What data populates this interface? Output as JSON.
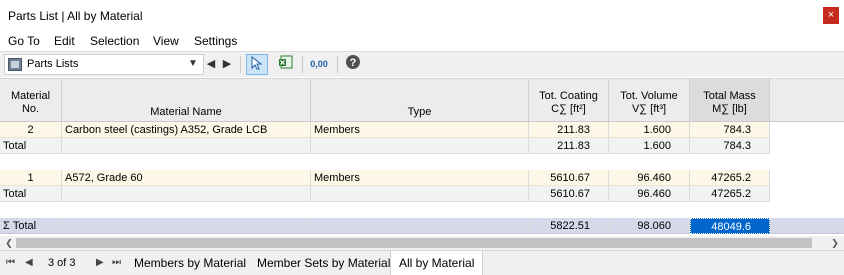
{
  "window": {
    "title": "Parts List | All by Material",
    "close_glyph": "×"
  },
  "menu": [
    "Go To",
    "Edit",
    "Selection",
    "View",
    "Settings"
  ],
  "toolbar": {
    "combo_value": "Parts Lists",
    "decimals_label": "0,00"
  },
  "table": {
    "headers": {
      "material_no": [
        "Material",
        "No."
      ],
      "material_name": "Material Name",
      "type": "Type",
      "coating": [
        "Tot. Coating",
        "C∑ [ft²]"
      ],
      "volume": [
        "Tot. Volume",
        "V∑ [ft³]"
      ],
      "mass": [
        "Total Mass",
        "M∑ [lb]"
      ]
    },
    "rows": [
      {
        "kind": "data",
        "no": "2",
        "name": "Carbon steel (castings) A352, Grade LCB",
        "type": "Members",
        "coating": "211.83",
        "volume": "1.600",
        "mass": "784.3"
      },
      {
        "kind": "total",
        "no": "Total",
        "name": "",
        "type": "",
        "coating": "211.83",
        "volume": "1.600",
        "mass": "784.3"
      },
      {
        "kind": "data",
        "no": "1",
        "name": "A572, Grade 60",
        "type": "Members",
        "coating": "5610.67",
        "volume": "96.460",
        "mass": "47265.2"
      },
      {
        "kind": "total",
        "no": "Total",
        "name": "",
        "type": "",
        "coating": "5610.67",
        "volume": "96.460",
        "mass": "47265.2"
      }
    ],
    "grand_total": {
      "label": "Σ Total",
      "coating": "5822.51",
      "volume": "98.060",
      "mass": "48049.6"
    }
  },
  "pagination": {
    "info": "3 of 3"
  },
  "tabs": [
    "Members by Material",
    "Member Sets by Material",
    "All by Material"
  ],
  "colors": {
    "selected_cell": "#0066cc",
    "grand_total_row": "#d6d9ea",
    "data_row": "#fdf7e7",
    "close_button": "#c42b1c"
  }
}
